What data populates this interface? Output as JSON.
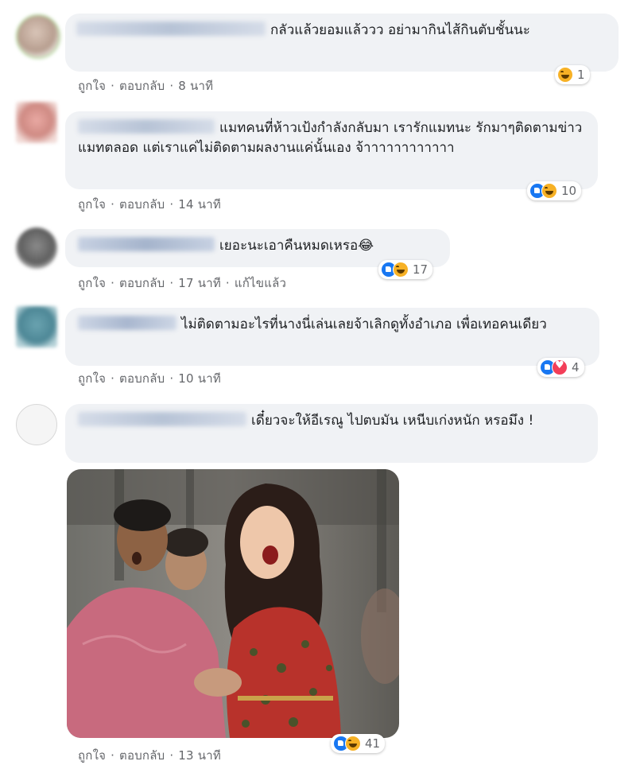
{
  "actions": {
    "like": "ถูกใจ",
    "reply": "ตอบกลับ",
    "separator": "·"
  },
  "comments": [
    {
      "text": "กลัวแล้วยอมแล้ววว อย่ามากินไส้กินตับชั้นนะ",
      "time": "8 นาที",
      "reaction_count": "1",
      "reactions": [
        "haha"
      ]
    },
    {
      "text": "แมทคนที่ห้าวเป้งกำลังกลับมา เรารักแมทนะ รักมาๆติดตามข่าวแมทตลอด แต่เราแค่ไม่ติดตามผลงานแค่นั้นเอง จ้าาาาาาาาาาาา",
      "time": "14 นาที",
      "reaction_count": "10",
      "reactions": [
        "like",
        "haha"
      ]
    },
    {
      "text": "เยอะนะเอาคืนหมดเหรอ😂",
      "time": "17 นาที",
      "edited": "แก้ไขแล้ว",
      "reaction_count": "17",
      "reactions": [
        "like",
        "haha"
      ]
    },
    {
      "text": "ไม่ติดตามอะไรที่นางนี่เล่นเลยจ้าเลิกดูทั้งอำเภอ เพื่อเทอคนเดียว",
      "time": "10 นาที",
      "reaction_count": "4",
      "reactions": [
        "like",
        "love"
      ]
    },
    {
      "text": "เดี๋ยวจะให้อีเรณู ไปตบมัน เหนีบเก่งหนัก หรอมึง !",
      "time": "13 นาที",
      "reaction_count": "41",
      "reactions": [
        "like",
        "haha"
      ]
    }
  ],
  "colors": {
    "bubble": "#f0f2f5",
    "meta": "#65676b",
    "like": "#1877f2",
    "haha": "#f7b125",
    "love": "#f33e58"
  }
}
